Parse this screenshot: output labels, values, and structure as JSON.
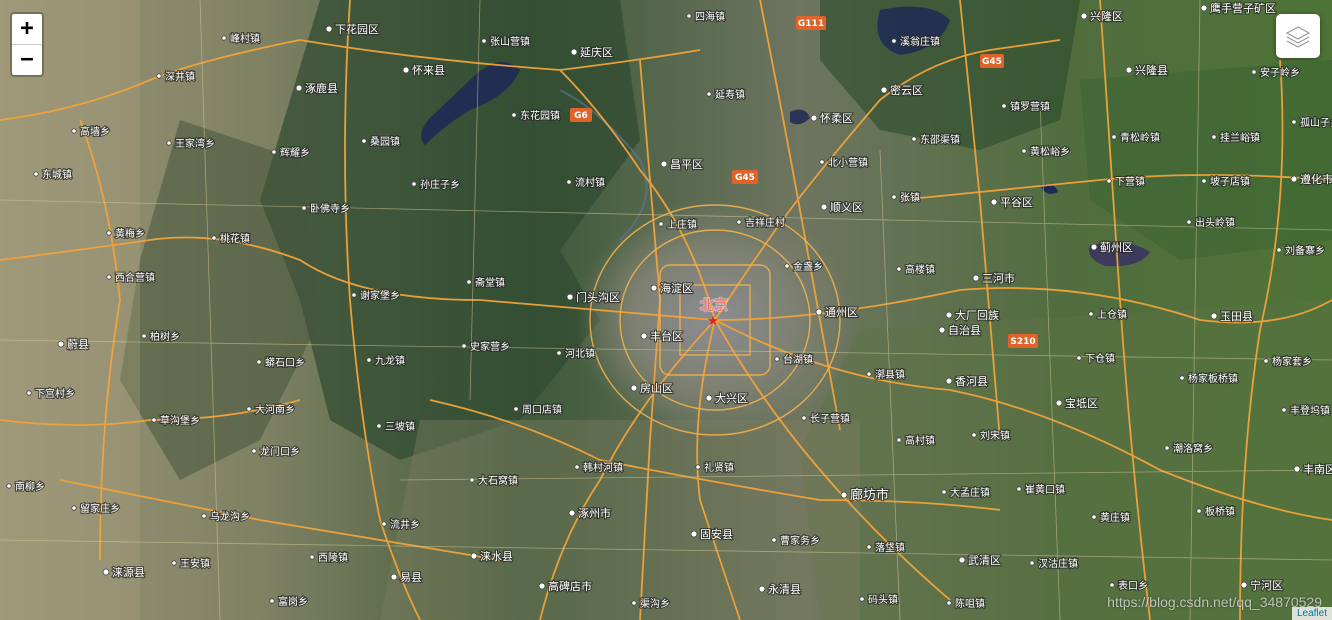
{
  "map": {
    "zoom_in_label": "+",
    "zoom_out_label": "−",
    "attribution": "Leaflet",
    "watermark": "https://blog.csdn.net/qq_34870529",
    "capital": {
      "name": "北京"
    },
    "road_shields": [
      "G111",
      "G45",
      "G6",
      "G45",
      "S210"
    ],
    "places": [
      {
        "name": "兴隆区",
        "kind": "district"
      },
      {
        "name": "四海镇",
        "kind": "town"
      },
      {
        "name": "溪翁庄镇",
        "kind": "town"
      },
      {
        "name": "鹰手营子矿区",
        "kind": "district"
      },
      {
        "name": "下花园区",
        "kind": "district"
      },
      {
        "name": "张山营镇",
        "kind": "town"
      },
      {
        "name": "延庆区",
        "kind": "district"
      },
      {
        "name": "峰村镇",
        "kind": "town"
      },
      {
        "name": "怀来县",
        "kind": "district"
      },
      {
        "name": "涿鹿县",
        "kind": "district"
      },
      {
        "name": "深井镇",
        "kind": "town"
      },
      {
        "name": "密云区",
        "kind": "district"
      },
      {
        "name": "兴隆县",
        "kind": "district"
      },
      {
        "name": "安子岭乡",
        "kind": "town"
      },
      {
        "name": "镇罗营镇",
        "kind": "town"
      },
      {
        "name": "延寿镇",
        "kind": "town"
      },
      {
        "name": "怀柔区",
        "kind": "district"
      },
      {
        "name": "东花园镇",
        "kind": "town"
      },
      {
        "name": "高墙乡",
        "kind": "town"
      },
      {
        "name": "王家湾乡",
        "kind": "town"
      },
      {
        "name": "桑园镇",
        "kind": "town"
      },
      {
        "name": "东邵渠镇",
        "kind": "town"
      },
      {
        "name": "青松岭镇",
        "kind": "town"
      },
      {
        "name": "挂兰峪镇",
        "kind": "town"
      },
      {
        "name": "孤山子乡",
        "kind": "town"
      },
      {
        "name": "辉耀乡",
        "kind": "town"
      },
      {
        "name": "昌平区",
        "kind": "district"
      },
      {
        "name": "北小营镇",
        "kind": "town"
      },
      {
        "name": "黄松峪乡",
        "kind": "town"
      },
      {
        "name": "东城镇",
        "kind": "town"
      },
      {
        "name": "孙庄子乡",
        "kind": "town"
      },
      {
        "name": "流村镇",
        "kind": "town"
      },
      {
        "name": "下营镇",
        "kind": "town"
      },
      {
        "name": "坡子店镇",
        "kind": "town"
      },
      {
        "name": "遵化市",
        "kind": "district"
      },
      {
        "name": "卧佛寺乡",
        "kind": "town"
      },
      {
        "name": "张镇",
        "kind": "town"
      },
      {
        "name": "顺义区",
        "kind": "district"
      },
      {
        "name": "平谷区",
        "kind": "district"
      },
      {
        "name": "上庄镇",
        "kind": "town"
      },
      {
        "name": "吉祥庄村",
        "kind": "town"
      },
      {
        "name": "出头岭镇",
        "kind": "town"
      },
      {
        "name": "黄梅乡",
        "kind": "town"
      },
      {
        "name": "桃花镇",
        "kind": "town"
      },
      {
        "name": "蓟州区",
        "kind": "district"
      },
      {
        "name": "刘备寨乡",
        "kind": "town"
      },
      {
        "name": "西合营镇",
        "kind": "town"
      },
      {
        "name": "斋堂镇",
        "kind": "town"
      },
      {
        "name": "金盏乡",
        "kind": "town"
      },
      {
        "name": "高楼镇",
        "kind": "town"
      },
      {
        "name": "三河市",
        "kind": "district"
      },
      {
        "name": "谢家堡乡",
        "kind": "town"
      },
      {
        "name": "门头沟区",
        "kind": "district"
      },
      {
        "name": "海淀区",
        "kind": "district"
      },
      {
        "name": "通州区",
        "kind": "district"
      },
      {
        "name": "大厂回族",
        "kind": "district"
      },
      {
        "name": "自治县",
        "kind": "district"
      },
      {
        "name": "上仓镇",
        "kind": "town"
      },
      {
        "name": "玉田县",
        "kind": "district"
      },
      {
        "name": "柏树乡",
        "kind": "town"
      },
      {
        "name": "丰台区",
        "kind": "district"
      },
      {
        "name": "史家营乡",
        "kind": "town"
      },
      {
        "name": "蔚县",
        "kind": "district"
      },
      {
        "name": "河北镇",
        "kind": "town"
      },
      {
        "name": "下仓镇",
        "kind": "town"
      },
      {
        "name": "杨家套乡",
        "kind": "town"
      },
      {
        "name": "蟒石口乡",
        "kind": "town"
      },
      {
        "name": "九龙镇",
        "kind": "town"
      },
      {
        "name": "台湖镇",
        "kind": "town"
      },
      {
        "name": "杨家板桥镇",
        "kind": "town"
      },
      {
        "name": "漷县镇",
        "kind": "town"
      },
      {
        "name": "香河县",
        "kind": "district"
      },
      {
        "name": "下宫村乡",
        "kind": "town"
      },
      {
        "name": "房山区",
        "kind": "district"
      },
      {
        "name": "大兴区",
        "kind": "district"
      },
      {
        "name": "宝坻区",
        "kind": "district"
      },
      {
        "name": "丰登坞镇",
        "kind": "town"
      },
      {
        "name": "大河南乡",
        "kind": "town"
      },
      {
        "name": "周口店镇",
        "kind": "town"
      },
      {
        "name": "草沟堡乡",
        "kind": "town"
      },
      {
        "name": "长子营镇",
        "kind": "town"
      },
      {
        "name": "三坡镇",
        "kind": "town"
      },
      {
        "name": "刘宋镇",
        "kind": "town"
      },
      {
        "name": "高村镇",
        "kind": "town"
      },
      {
        "name": "龙门口乡",
        "kind": "town"
      },
      {
        "name": "潮洛窝乡",
        "kind": "town"
      },
      {
        "name": "韩村河镇",
        "kind": "town"
      },
      {
        "name": "礼贤镇",
        "kind": "town"
      },
      {
        "name": "丰南区",
        "kind": "district"
      },
      {
        "name": "大石窝镇",
        "kind": "town"
      },
      {
        "name": "廊坊市",
        "kind": "major"
      },
      {
        "name": "大孟庄镇",
        "kind": "town"
      },
      {
        "name": "崔黄口镇",
        "kind": "town"
      },
      {
        "name": "南柳乡",
        "kind": "town"
      },
      {
        "name": "留家庄乡",
        "kind": "town"
      },
      {
        "name": "乌龙沟乡",
        "kind": "town"
      },
      {
        "name": "涿州市",
        "kind": "district"
      },
      {
        "name": "黄庄镇",
        "kind": "town"
      },
      {
        "name": "板桥镇",
        "kind": "town"
      },
      {
        "name": "流井乡",
        "kind": "town"
      },
      {
        "name": "固安县",
        "kind": "district"
      },
      {
        "name": "曹家务乡",
        "kind": "town"
      },
      {
        "name": "王安镇",
        "kind": "town"
      },
      {
        "name": "西陵镇",
        "kind": "town"
      },
      {
        "name": "涞水县",
        "kind": "district"
      },
      {
        "name": "落垡镇",
        "kind": "town"
      },
      {
        "name": "武清区",
        "kind": "district"
      },
      {
        "name": "汊沽庄镇",
        "kind": "town"
      },
      {
        "name": "涞源县",
        "kind": "district"
      },
      {
        "name": "易县",
        "kind": "district"
      },
      {
        "name": "高碑店市",
        "kind": "district"
      },
      {
        "name": "永清县",
        "kind": "district"
      },
      {
        "name": "表口乡",
        "kind": "town"
      },
      {
        "name": "宁河区",
        "kind": "district"
      },
      {
        "name": "富岗乡",
        "kind": "town"
      },
      {
        "name": "渠沟乡",
        "kind": "town"
      },
      {
        "name": "码头镇",
        "kind": "town"
      },
      {
        "name": "陈咀镇",
        "kind": "town"
      }
    ]
  }
}
